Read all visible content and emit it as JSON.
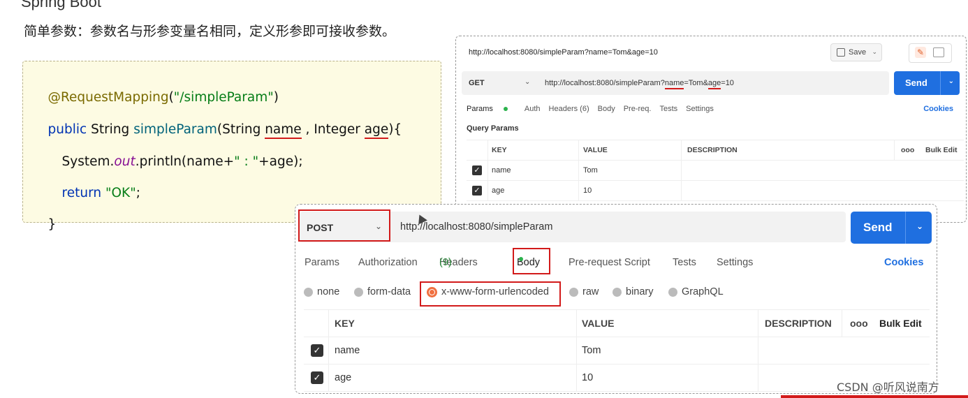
{
  "heading": "简单参数：参数名与形参变量名相同，定义形参即可接收参数。",
  "top_fragment": "Spring Boot",
  "code": {
    "line1_ann": "@RequestMapping",
    "line1_paren_open": "(",
    "line1_str": "\"/simpleParam\"",
    "line1_paren_close": ")",
    "line2_public": "public",
    "line2_string": " String ",
    "line2_fn": "simpleParam",
    "line2_open": "(String ",
    "line2_name": "name",
    "line2_mid": " , Integer ",
    "line2_age": "age",
    "line2_close": "){",
    "line3_sys": "System.",
    "line3_out": "out",
    "line3_print": ".println(name+",
    "line3_str": "\" : \"",
    "line3_end": "+age);",
    "line4_return": "return",
    "line4_str": " \"OK\"",
    "line4_end": ";",
    "line5": "}"
  },
  "get_window": {
    "tab_title": "http://localhost:8080/simpleParam?name=Tom&age=10",
    "save_label": "Save",
    "method": "GET",
    "url_prefix": "http://localhost:8080/simpleParam?",
    "url_name": "name",
    "url_mid": "=Tom&",
    "url_age": "age",
    "url_end": "=10",
    "send_label": "Send",
    "tabs": [
      "Params",
      "Auth",
      "Headers (6)",
      "Body",
      "Pre-req.",
      "Tests",
      "Settings"
    ],
    "cookies_label": "Cookies",
    "query_params_label": "Query Params",
    "headers": {
      "key": "KEY",
      "value": "VALUE",
      "description": "DESCRIPTION",
      "dots": "ooo",
      "bulk": "Bulk Edit"
    },
    "rows": [
      {
        "key": "name",
        "value": "Tom"
      },
      {
        "key": "age",
        "value": "10"
      }
    ]
  },
  "post_window": {
    "method": "POST",
    "url": "http://localhost:8080/simpleParam",
    "send_label": "Send",
    "tabs": {
      "params": "Params",
      "authorization": "Authorization",
      "headers": "Headers",
      "headers_count": "(9)",
      "body": "Body",
      "prerequest": "Pre-request Script",
      "tests": "Tests",
      "settings": "Settings"
    },
    "cookies_label": "Cookies",
    "body_types": [
      "none",
      "form-data",
      "x-www-form-urlencoded",
      "raw",
      "binary",
      "GraphQL"
    ],
    "headers": {
      "key": "KEY",
      "value": "VALUE",
      "description": "DESCRIPTION",
      "dots": "ooo",
      "bulk": "Bulk Edit"
    },
    "rows": [
      {
        "key": "name",
        "value": "Tom"
      },
      {
        "key": "age",
        "value": "10"
      }
    ]
  },
  "watermark": "CSDN @听风说南方",
  "colors": {
    "accent": "#1f6fe0",
    "highlight": "#d21a1a",
    "active_dot": "#2bb24c",
    "radio_active": "#f07040"
  }
}
